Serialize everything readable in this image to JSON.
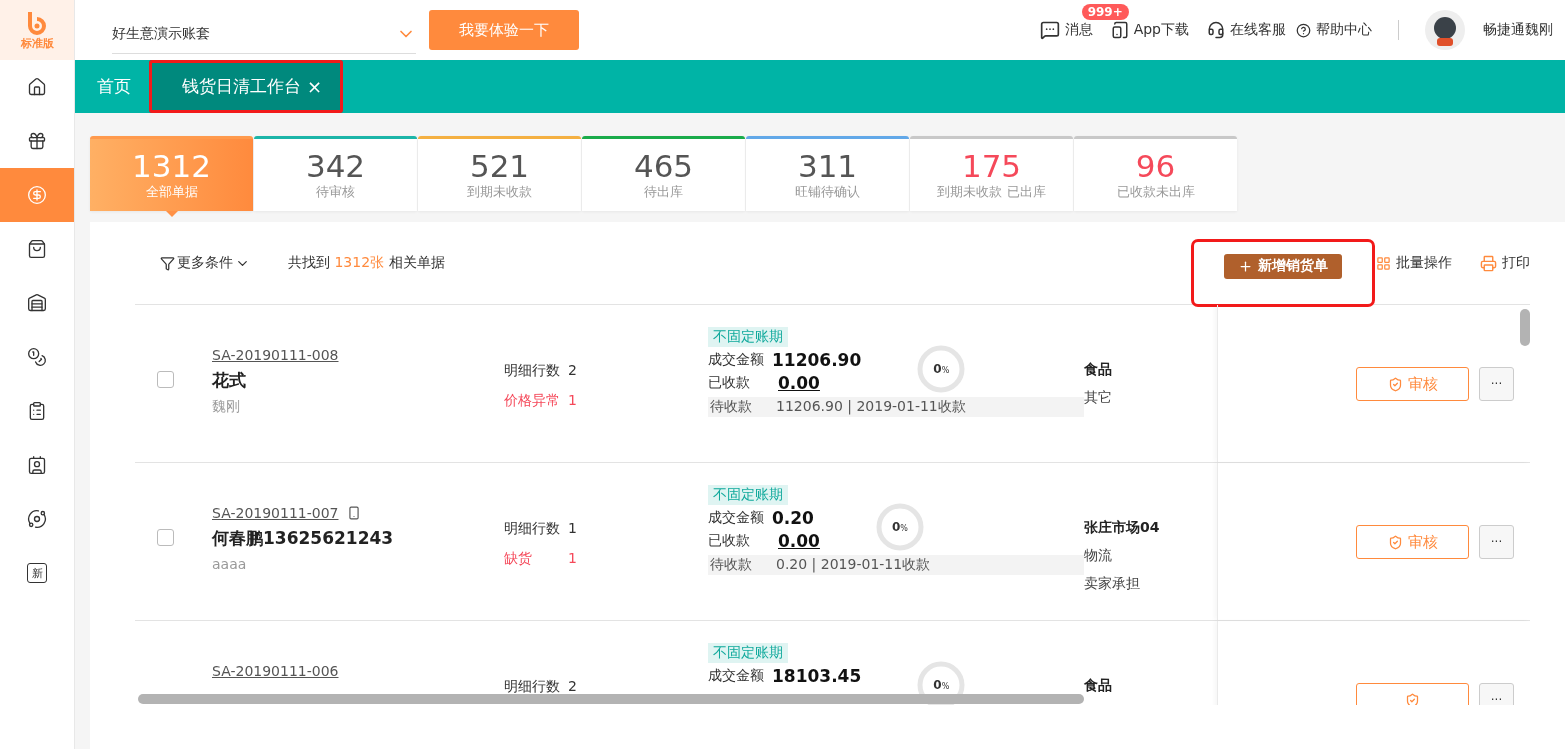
{
  "logo": {
    "edition": "标准版"
  },
  "sidebar": {
    "items": [
      {
        "kind": "home",
        "selected": false
      },
      {
        "kind": "gift",
        "selected": false
      },
      {
        "kind": "money-house",
        "selected": true
      },
      {
        "kind": "bag",
        "selected": false
      },
      {
        "kind": "warehouse",
        "selected": false
      },
      {
        "kind": "money-bag",
        "selected": false
      },
      {
        "kind": "clipboard",
        "selected": false
      },
      {
        "kind": "card",
        "selected": false
      },
      {
        "kind": "orbit",
        "selected": false
      },
      {
        "kind": "glyph",
        "glyph": "新",
        "selected": false
      }
    ]
  },
  "header": {
    "account": "好生意演示账套",
    "try_button": "我要体验一下",
    "messages": {
      "label": "消息",
      "badge": "999+"
    },
    "app_download": "App下载",
    "service": "在线客服",
    "help": "帮助中心",
    "user": "畅捷通魏刚"
  },
  "tabs": [
    {
      "label": "首页",
      "selected": false,
      "highlighted": false
    },
    {
      "label": "钱货日清工作台",
      "selected": true,
      "close": "×",
      "highlighted": true
    }
  ],
  "stats": [
    {
      "value": "1312",
      "label": "全部单据",
      "selected": true,
      "color": "#ff9a4d",
      "warning": false
    },
    {
      "value": "342",
      "label": "待审核",
      "selected": false,
      "color": "#1cb5a8",
      "warning": false
    },
    {
      "value": "521",
      "label": "到期未收款",
      "selected": false,
      "color": "#f4b042",
      "warning": false
    },
    {
      "value": "465",
      "label": "待出库",
      "selected": false,
      "color": "#1aab4a",
      "warning": false
    },
    {
      "value": "311",
      "label": "旺铺待确认",
      "selected": false,
      "color": "#62a8e8",
      "warning": false
    },
    {
      "value": "175",
      "label": "到期未收款 已出库",
      "selected": false,
      "color": "#c8c8c8",
      "warning": true
    },
    {
      "value": "96",
      "label": "已收款未出库",
      "selected": false,
      "color": "#c8c8c8",
      "warning": true
    }
  ],
  "toolbar": {
    "filter": "更多条件",
    "found_prefix": "共找到",
    "found_count": "1312张",
    "found_suffix": "相关单据",
    "new_button": "新增销货单",
    "new_highlighted": true,
    "batch": "批量操作",
    "print": "打印"
  },
  "rows": [
    {
      "checked": false,
      "code": "SA-20190111-008",
      "device_icon": false,
      "name": "花式",
      "salesman": "魏刚",
      "detail_label": "明细行数",
      "detail_count": "2",
      "issue_label": "价格异常",
      "issue_count": "1",
      "tag": "不固定账期",
      "amount_label": "成交金额",
      "amount": "11206.90",
      "received_label": "已收款",
      "received": "0.00",
      "pending_label": "待收款",
      "pending": "11206.90 | 2019-01-11收款",
      "level": 0,
      "percent": "0",
      "unit": "%",
      "category": "食品",
      "notes": [
        "其它"
      ],
      "audit": "审核",
      "more": "···"
    },
    {
      "checked": false,
      "code": "SA-20190111-007",
      "device_icon": true,
      "name": "何春鹏13625621243",
      "salesman": "aaaa",
      "detail_label": "明细行数",
      "detail_count": "1",
      "issue_label": "缺货",
      "issue_count": "1",
      "tag": "不固定账期",
      "amount_label": "成交金额",
      "amount": "0.20",
      "received_label": "已收款",
      "received": "0.00",
      "pending_label": "待收款",
      "pending": "0.20 | 2019-01-11收款",
      "level": 0,
      "percent": "0",
      "unit": "%",
      "category": "张庄市场04",
      "notes": [
        "物流",
        "卖家承担"
      ],
      "audit": "审核",
      "more": "···"
    },
    {
      "code": "SA-20190111-006",
      "device_icon": false,
      "detail_label": "明细行数",
      "detail_count": "2",
      "tag": "不固定账期",
      "amount_label": "成交金额",
      "amount": "18103.45",
      "level": 0,
      "percent": "0",
      "unit": "%",
      "category": "食品",
      "more": "···"
    }
  ]
}
